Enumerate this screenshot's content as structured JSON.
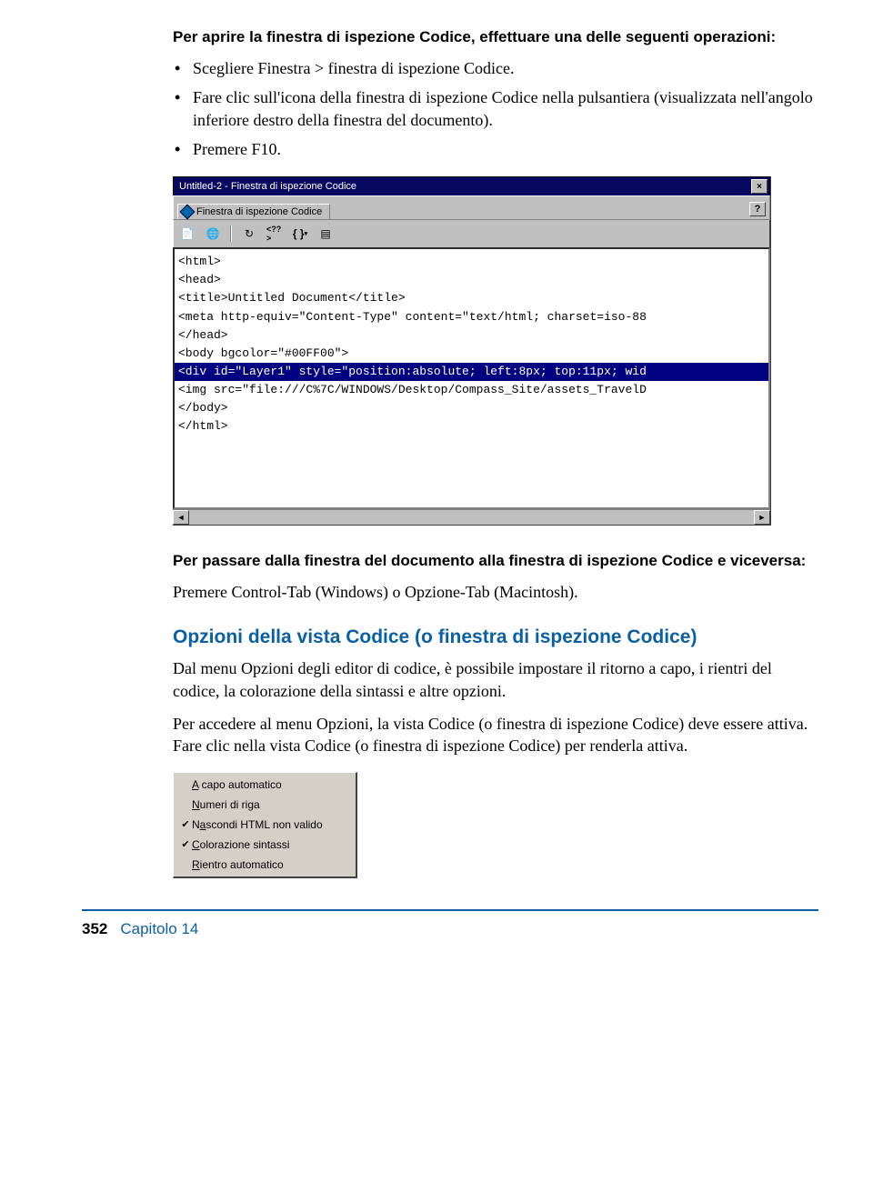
{
  "intro_bold": "Per aprire la finestra di ispezione Codice, effettuare una delle seguenti operazioni:",
  "bullets": [
    "Scegliere Finestra > finestra di ispezione Codice.",
    "Fare clic sull'icona della finestra di ispezione Codice nella pulsantiera (visualizzata nell'angolo inferiore destro della finestra del documento).",
    "Premere F10."
  ],
  "window": {
    "title": "Untitled-2 - Finestra di ispezione Codice",
    "tab": "Finestra di ispezione Codice",
    "help": "?",
    "close": "×",
    "toolbar_icons": [
      "file-icon",
      "globe-icon",
      "refresh-icon",
      "php-icon",
      "braces-icon",
      "options-icon"
    ],
    "code": {
      "l1": "<html>",
      "l2": "<head>",
      "l3": "<title>Untitled Document</title>",
      "l4": "<meta http-equiv=\"Content-Type\" content=\"text/html; charset=iso-88",
      "l5": "</head>",
      "l6": "",
      "l7": "<body bgcolor=\"#00FF00\">",
      "l8": "<div id=\"Layer1\" style=\"position:absolute; left:8px; top:11px; wid",
      "l9": "<img src=\"file:///C%7C/WINDOWS/Desktop/Compass_Site/assets_TravelD",
      "l10": "</body>",
      "l11": "</html>"
    }
  },
  "para2_bold": "Per passare dalla finestra del documento alla finestra di ispezione Codice e viceversa:",
  "para2_body": "Premere Control-Tab (Windows) o Opzione-Tab (Macintosh).",
  "section_heading": "Opzioni della vista Codice (o finestra di ispezione Codice)",
  "para3": "Dal menu Opzioni degli editor di codice, è possibile impostare il ritorno a capo, i rientri del codice, la colorazione della sintassi e altre opzioni.",
  "para4": "Per accedere al menu Opzioni, la vista Codice (o finestra di ispezione Codice) deve essere attiva. Fare clic nella vista Codice (o finestra di ispezione Codice) per renderla attiva.",
  "menu": {
    "items": [
      {
        "checked": false,
        "pre": "",
        "u": "A",
        "post": " capo automatico"
      },
      {
        "checked": false,
        "pre": "",
        "u": "N",
        "post": "umeri di riga"
      },
      {
        "checked": true,
        "pre": "N",
        "u": "a",
        "post": "scondi HTML non valido"
      },
      {
        "checked": true,
        "pre": "",
        "u": "C",
        "post": "olorazione sintassi"
      },
      {
        "checked": false,
        "pre": "",
        "u": "R",
        "post": "ientro automatico"
      }
    ]
  },
  "footer": {
    "page": "352",
    "chapter": "Capitolo 14"
  }
}
